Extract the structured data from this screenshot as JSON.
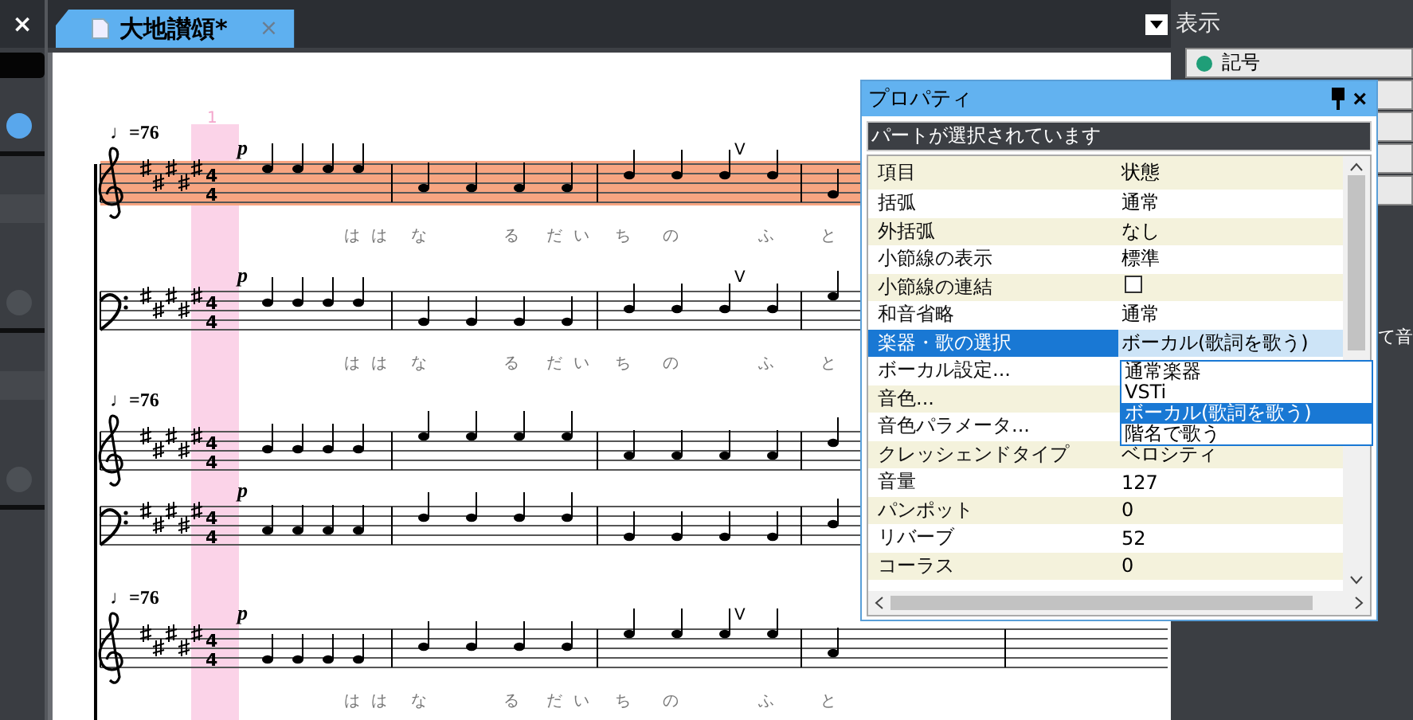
{
  "left_panel": {
    "close": "×"
  },
  "tab": {
    "title": "大地讃頌*",
    "selected": true,
    "close": "×"
  },
  "score": {
    "measure_number": "1",
    "staves": [
      {
        "kind": "treble",
        "tempo": "♩=76",
        "dynamic": "p",
        "breath": "V",
        "highlighted": true,
        "time_signature": [
          "4",
          "4"
        ],
        "lyrics": [
          "は",
          "は",
          "な",
          "る",
          "だ",
          "い",
          "ち",
          "の",
          "ふ",
          "と"
        ]
      },
      {
        "kind": "bass",
        "dynamic": "p",
        "breath": "V",
        "highlighted": false,
        "time_signature": [
          "4",
          "4"
        ],
        "lyrics": [
          "は",
          "は",
          "な",
          "る",
          "だ",
          "い",
          "ち",
          "の",
          "ふ",
          "と"
        ]
      },
      {
        "kind": "treble",
        "tempo": "♩=76",
        "highlighted": false,
        "time_signature": [
          "4",
          "4"
        ]
      },
      {
        "kind": "bass",
        "dynamic": "p",
        "highlighted": false,
        "time_signature": [
          "4",
          "4"
        ]
      },
      {
        "kind": "treble",
        "tempo": "♩=76",
        "dynamic": "p",
        "breath": "V",
        "highlighted": false,
        "time_signature": [
          "4",
          "4"
        ],
        "lyrics": [
          "は",
          "は",
          "な",
          "る",
          "だ",
          "い",
          "ち",
          "の",
          "ふ",
          "と"
        ]
      }
    ]
  },
  "view_panel": {
    "title": "表示",
    "items": [
      {
        "label": "記号",
        "color": "#1f9e78"
      }
    ],
    "info_fragment": "て音"
  },
  "properties": {
    "title": "プロパティ",
    "close": "×",
    "status": "パートが選択されています",
    "columns": [
      "項目",
      "状態"
    ],
    "rows": [
      {
        "kind": "text",
        "name": "括弧",
        "value": "通常",
        "selected": false
      },
      {
        "kind": "text",
        "name": "外括弧",
        "value": "なし",
        "selected": false
      },
      {
        "kind": "text",
        "name": "小節線の表示",
        "value": "標準",
        "selected": false
      },
      {
        "kind": "checkbox",
        "name": "小節線の連結",
        "checked": false,
        "selected": false
      },
      {
        "kind": "text",
        "name": "和音省略",
        "value": "通常",
        "selected": false
      },
      {
        "kind": "select",
        "name": "楽器・歌の選択",
        "value": "ボーカル(歌詞を歌う)",
        "selected": true
      },
      {
        "kind": "text",
        "name": "ボーカル設定...",
        "selected": false
      },
      {
        "kind": "text",
        "name": "音色...",
        "selected": false
      },
      {
        "kind": "text",
        "name": "音色パラメータ...",
        "selected": false
      },
      {
        "kind": "text",
        "name": "クレッシェンドタイプ",
        "value": "ベロシティ",
        "selected": false
      },
      {
        "kind": "text",
        "name": "音量",
        "value": "127",
        "selected": false
      },
      {
        "kind": "text",
        "name": "パンポット",
        "value": "0",
        "selected": false
      },
      {
        "kind": "text",
        "name": "リバーブ",
        "value": "52",
        "selected": false
      },
      {
        "kind": "text",
        "name": "コーラス",
        "value": "0",
        "selected": false
      }
    ],
    "dropdown": [
      {
        "label": "通常楽器",
        "selected": false
      },
      {
        "label": "VSTi",
        "selected": false
      },
      {
        "label": "ボーカル(歌詞を歌う)",
        "selected": true
      },
      {
        "label": "階名で歌う",
        "selected": false
      }
    ]
  }
}
